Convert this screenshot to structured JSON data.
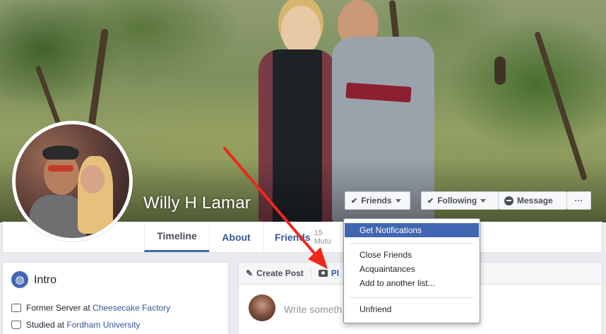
{
  "profile": {
    "name": "Willy H Lamar"
  },
  "cover_actions": {
    "friends_label": "Friends",
    "following_label": "Following",
    "message_label": "Message",
    "more_label": "···"
  },
  "timeline_nav": {
    "timeline": "Timeline",
    "about": "About",
    "friends": "Friends",
    "friends_sub": "15 Mutu"
  },
  "friends_menu": {
    "items": [
      "Get Notifications",
      "Close Friends",
      "Acquaintances",
      "Add to another list...",
      "Unfriend"
    ]
  },
  "intro": {
    "title": "Intro",
    "rows": [
      {
        "prefix": "Former Server at ",
        "link": "Cheesecake Factory"
      },
      {
        "prefix": "Studied at ",
        "link": "Fordham University"
      }
    ]
  },
  "composer": {
    "create_post": "Create Post",
    "photo_tab": "Pl",
    "placeholder": "Write someth"
  },
  "colors": {
    "accent": "#4267b2",
    "link": "#365899",
    "arrow": "#f0271b"
  }
}
